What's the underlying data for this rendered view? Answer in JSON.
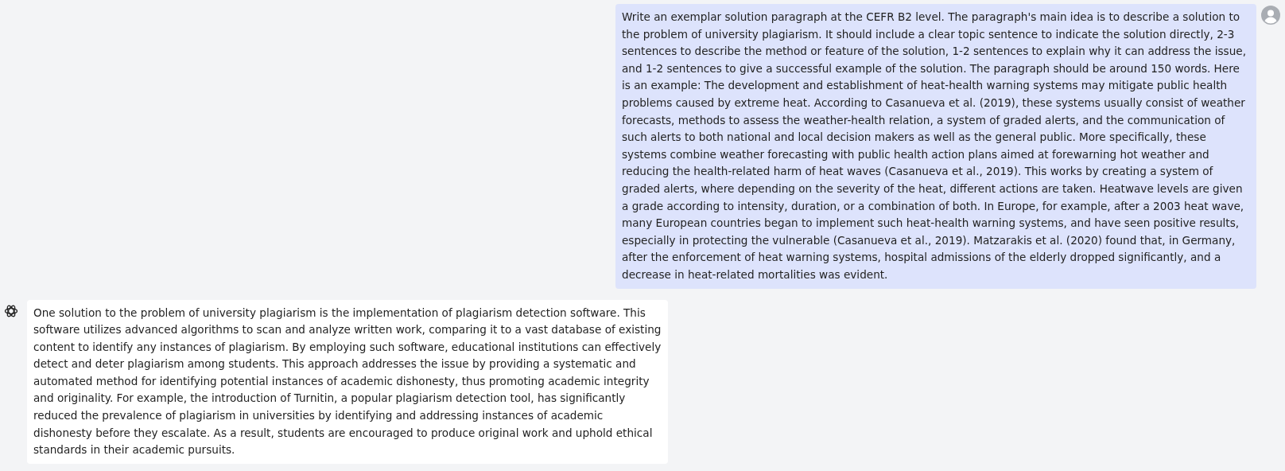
{
  "messages": [
    {
      "kind": "user",
      "text": "Write an exemplar solution paragraph at the CEFR B2 level. The paragraph's main idea is to describe a solution to the problem of university plagiarism. It should include a clear topic sentence to indicate the solution directly, 2-3 sentences to describe the method or feature of the solution, 1-2 sentences to explain why it can address the issue, and 1-2 sentences to give a successful example of the solution. The paragraph should be around 150 words. Here is an example: The development and establishment of heat-health warning systems may mitigate public health problems caused by extreme heat. According to Casanueva et al. (2019), these systems usually consist of weather forecasts, methods to assess the weather-health relation, a system of graded alerts, and the communication of such alerts to both national and local decision makers as well as the general public. More specifically, these systems combine weather forecasting with public health action plans aimed at forewarning hot weather and reducing the health-related harm of heat waves (Casanueva et al., 2019). This works by creating a system of graded alerts, where depending on the severity of the heat, different actions are taken. Heatwave levels are given a grade according to intensity, duration, or a combination of both. In Europe, for example, after a 2003 heat wave, many European countries began to implement such heat-health warning systems, and have seen positive results, especially in protecting the vulnerable (Casanueva et al., 2019). Matzarakis et al. (2020) found that, in Germany, after the enforcement of heat warning systems, hospital admissions of the elderly dropped significantly, and a decrease in heat-related mortalities was evident."
    },
    {
      "kind": "assistant",
      "text": "One solution to the problem of university plagiarism is the implementation of plagiarism detection software. This software utilizes advanced algorithms to scan and analyze written work, comparing it to a vast database of existing content to identify any instances of plagiarism. By employing such software, educational institutions can effectively detect and deter plagiarism among students. This approach addresses the issue by providing a systematic and automated method for identifying potential instances of academic dishonesty, thus promoting academic integrity and originality. For example, the introduction of Turnitin, a popular plagiarism detection tool, has significantly reduced the prevalence of plagiarism in universities by identifying and addressing instances of academic dishonesty before they escalate. As a result, students are encouraged to produce original work and uphold ethical standards in their academic pursuits."
    }
  ]
}
